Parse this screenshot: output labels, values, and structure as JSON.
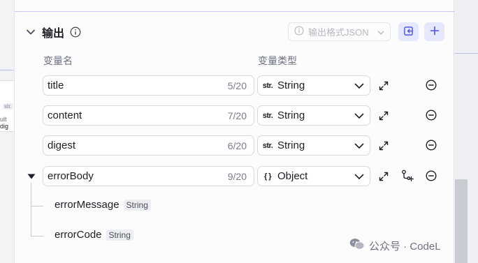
{
  "canvas": {
    "left_tag": "str.",
    "left_fragment_prefix": "ult",
    "left_fragment_word": "dig"
  },
  "output_section": {
    "title": "输出",
    "format_button_label": "输出格式JSON",
    "column_name_header": "变量名",
    "column_type_header": "变量类型"
  },
  "variables": [
    {
      "name": "title",
      "count": "5/20",
      "type_icon": "str.",
      "type": "String"
    },
    {
      "name": "content",
      "count": "7/20",
      "type_icon": "str.",
      "type": "String"
    },
    {
      "name": "digest",
      "count": "6/20",
      "type_icon": "str.",
      "type": "String"
    },
    {
      "name": "errorBody",
      "count": "9/20",
      "type_icon": "{ }",
      "type": "Object"
    }
  ],
  "children": [
    {
      "name": "errorMessage",
      "type": "String"
    },
    {
      "name": "errorCode",
      "type": "String"
    }
  ],
  "watermark": {
    "text": "公众号 · CodeL"
  },
  "colors": {
    "accent": "#4d53e8",
    "accent_bg": "#e6e8fd",
    "muted_text": "#6b6f80"
  }
}
